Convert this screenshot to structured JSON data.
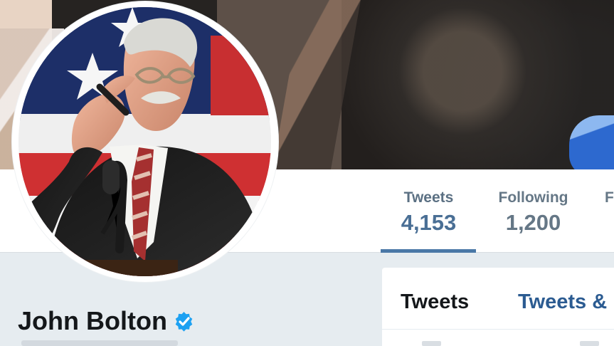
{
  "profile": {
    "name": "John Bolton",
    "verified_icon": "verified-check-icon",
    "avatar_icon": "profile-photo"
  },
  "stats": {
    "tweets_label": "Tweets",
    "tweets_value": "4,153",
    "following_label": "Following",
    "following_value": "1,200",
    "followers_label": "F"
  },
  "tabs": [
    {
      "label": "Tweets",
      "selected": true
    },
    {
      "label": "Tweets &",
      "selected": false
    }
  ],
  "colors": {
    "link_blue": "#2b5b91",
    "active_blue": "#4a78a7",
    "muted_text": "#657786",
    "page_bg": "#e6ecf0",
    "verified_blue": "#1da1f2"
  }
}
